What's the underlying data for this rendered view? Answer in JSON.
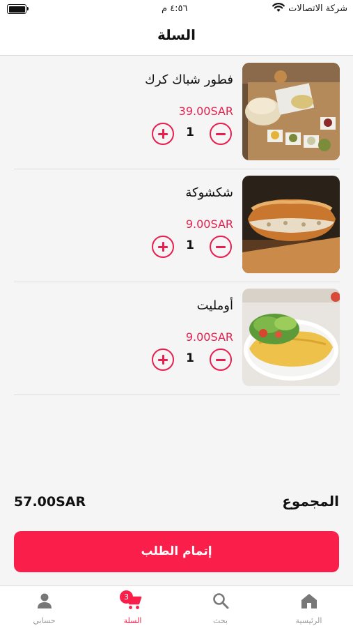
{
  "status_bar": {
    "carrier": "شركة الاتصالات",
    "time": "٤:٥٦ م"
  },
  "header": {
    "title": "السلة"
  },
  "cart": {
    "items": [
      {
        "name": "فطور شباك كرك",
        "price": "39.00SAR",
        "quantity": "1"
      },
      {
        "name": "شكشوكة",
        "price": "9.00SAR",
        "quantity": "1"
      },
      {
        "name": "أومليت",
        "price": "9.00SAR",
        "quantity": "1"
      }
    ]
  },
  "summary": {
    "total_label": "المجموع",
    "total_value": "57.00SAR"
  },
  "checkout": {
    "label": "إتمام الطلب"
  },
  "tabbar": {
    "tabs": [
      {
        "label": "حسابي",
        "icon": "person-icon"
      },
      {
        "label": "السلة",
        "icon": "cart-icon",
        "badge": "3",
        "active": true
      },
      {
        "label": "بحث",
        "icon": "search-icon"
      },
      {
        "label": "الرئيسية",
        "icon": "home-icon"
      }
    ]
  },
  "colors": {
    "accent": "#f91f4a",
    "price": "#e91e4f"
  }
}
